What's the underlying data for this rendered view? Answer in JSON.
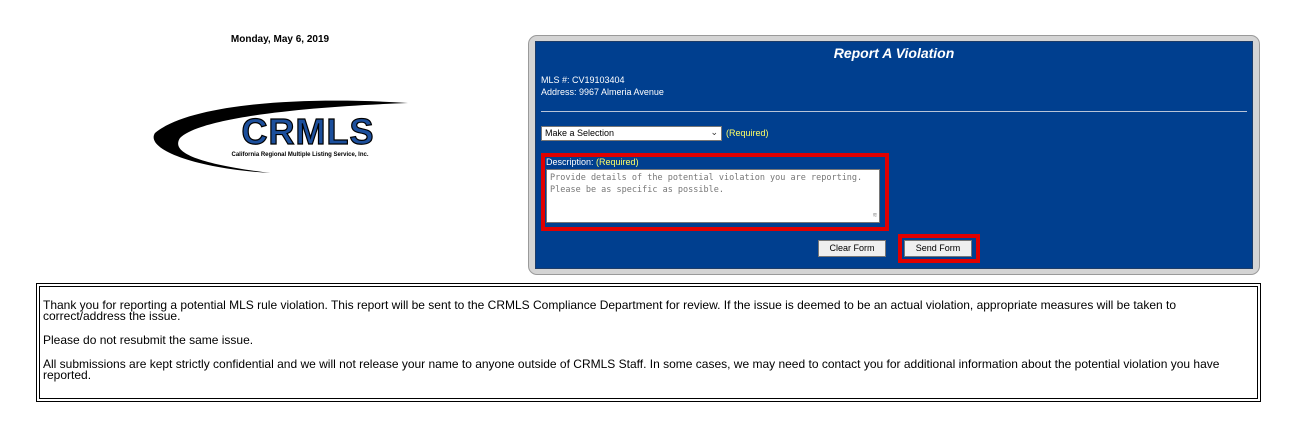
{
  "header": {
    "date": "Monday, May 6, 2019"
  },
  "logo": {
    "name": "CRMLS",
    "tagline": "California Regional Multiple Listing Service, Inc.",
    "brand_color": "#1c4f9c"
  },
  "form": {
    "title": "Report A Violation",
    "mls_number": "MLS #: CV19103404",
    "address": "Address: 9967 Almeria Avenue",
    "select_value": "Make a Selection",
    "select_required": "(Required)",
    "description_label": "Description:",
    "description_required": "(Required)",
    "description_placeholder": "Provide details of the potential violation you are reporting. Please be as specific as possible.",
    "clear_label": "Clear Form",
    "send_label": "Send Form",
    "panel_color": "#003f8f",
    "required_color": "#ffff66",
    "highlight_color": "#e00000"
  },
  "notice": {
    "paragraphs": [
      "Thank you for reporting a potential MLS rule violation. This report will be sent to the CRMLS Compliance Department for review. If the issue is deemed to be an actual violation, appropriate measures will be taken to correct/address the issue.",
      "Please do not resubmit the same issue.",
      "All submissions are kept strictly confidential and we will not release your name to anyone outside of CRMLS Staff. In some cases, we may need to contact you for additional information about the potential violation you have reported."
    ]
  }
}
